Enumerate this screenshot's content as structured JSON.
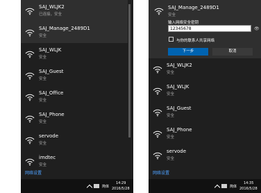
{
  "left_panel": {
    "networks": [
      {
        "ssid": "SAJ_WLJK2",
        "status": "已连接，安全"
      },
      {
        "ssid": "SAJ_Manage_2489D1",
        "status": "安全"
      },
      {
        "ssid": "SAJ_WLJK",
        "status": "安全"
      },
      {
        "ssid": "SAJ_Guest",
        "status": "安全"
      },
      {
        "ssid": "SAJ_Office",
        "status": "安全"
      },
      {
        "ssid": "SAJ_Phone",
        "status": "安全"
      },
      {
        "ssid": "servode",
        "status": "安全"
      },
      {
        "ssid": "imdtec",
        "status": "安全"
      }
    ],
    "network_settings": "网络设置",
    "taskbar": {
      "lang": "简体",
      "time": "14:29",
      "date": "2016/5/28"
    }
  },
  "right_panel": {
    "connect": {
      "ssid": "SAJ_Manage_2489D1",
      "status": "安全",
      "key_label": "输入网络安全密钥",
      "password": "12345678",
      "share_label": "与你的联系人共享网络",
      "next_label": "下一步",
      "cancel_label": "取消"
    },
    "networks": [
      {
        "ssid": "SAJ_WLJK2",
        "status": "安全"
      },
      {
        "ssid": "SAJ_WLJK",
        "status": "安全"
      },
      {
        "ssid": "SAJ_Guest",
        "status": "安全"
      },
      {
        "ssid": "SAJ_Phone",
        "status": "安全"
      },
      {
        "ssid": "servode",
        "status": "安全"
      }
    ],
    "network_settings": "网络设置",
    "taskbar": {
      "lang": "简体",
      "time": "14:35",
      "date": "2016/5/28"
    }
  },
  "colors": {
    "panel_bg": "#1f1f1f",
    "active_bg": "#2f2f2f",
    "accent": "#0063b1",
    "link": "#4ea1ff"
  },
  "icons": {
    "network": "wifi-icon",
    "password_toggle": "eye-icon"
  }
}
